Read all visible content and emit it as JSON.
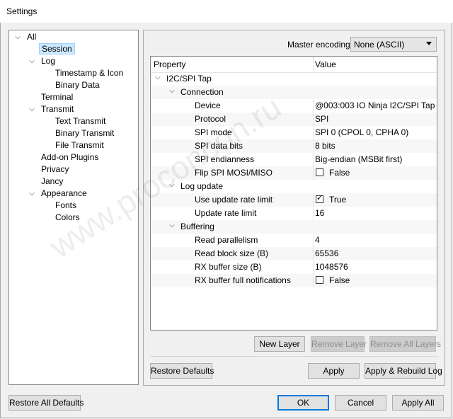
{
  "window": {
    "title": "Settings"
  },
  "tree": [
    {
      "label": "All",
      "arrow": "expanded",
      "indent": 0
    },
    {
      "label": "Session",
      "arrow": "",
      "indent": 1,
      "selected": true
    },
    {
      "label": "Log",
      "arrow": "expanded",
      "indent": 1
    },
    {
      "label": "Timestamp & Icon",
      "arrow": "",
      "indent": 2
    },
    {
      "label": "Binary Data",
      "arrow": "",
      "indent": 2
    },
    {
      "label": "Terminal",
      "arrow": "",
      "indent": 1
    },
    {
      "label": "Transmit",
      "arrow": "expanded",
      "indent": 1
    },
    {
      "label": "Text Transmit",
      "arrow": "",
      "indent": 2
    },
    {
      "label": "Binary Transmit",
      "arrow": "",
      "indent": 2
    },
    {
      "label": "File Transmit",
      "arrow": "",
      "indent": 2
    },
    {
      "label": "Add-on Plugins",
      "arrow": "",
      "indent": 1
    },
    {
      "label": "Privacy",
      "arrow": "",
      "indent": 1
    },
    {
      "label": "Jancy",
      "arrow": "",
      "indent": 1
    },
    {
      "label": "Appearance",
      "arrow": "expanded",
      "indent": 1
    },
    {
      "label": "Fonts",
      "arrow": "",
      "indent": 2
    },
    {
      "label": "Colors",
      "arrow": "",
      "indent": 2
    }
  ],
  "encoding": {
    "label": "Master encoding:",
    "value": "None (ASCII)"
  },
  "grid": {
    "header": {
      "property": "Property",
      "value": "Value"
    },
    "rows": [
      {
        "key": "I2C/SPI Tap",
        "level": 0,
        "toggle": "collapse"
      },
      {
        "key": "Connection",
        "level": 1,
        "toggle": "collapse"
      },
      {
        "key": "Device",
        "level": 2,
        "value": "@003:003 IO Ninja I2C/SPI Tap"
      },
      {
        "key": "Protocol",
        "level": 2,
        "value": "SPI"
      },
      {
        "key": "SPI mode",
        "level": 2,
        "value": "SPI 0 (CPOL 0, CPHA 0)"
      },
      {
        "key": "SPI data bits",
        "level": 2,
        "value": "8 bits"
      },
      {
        "key": "SPI endianness",
        "level": 2,
        "value": "Big-endian (MSBit first)"
      },
      {
        "key": "Flip SPI MOSI/MISO",
        "level": 2,
        "checkbox": false,
        "value": "False"
      },
      {
        "key": "Log update",
        "level": 1,
        "toggle": "collapse"
      },
      {
        "key": "Use update rate limit",
        "level": 2,
        "checkbox": true,
        "value": "True"
      },
      {
        "key": "Update rate limit",
        "level": 2,
        "value": "16"
      },
      {
        "key": "Buffering",
        "level": 1,
        "toggle": "collapse"
      },
      {
        "key": "Read parallelism",
        "level": 2,
        "value": "4"
      },
      {
        "key": "Read block size (B)",
        "level": 2,
        "value": "65536"
      },
      {
        "key": "RX buffer size (B)",
        "level": 2,
        "value": "1048576"
      },
      {
        "key": "RX buffer full notifications",
        "level": 2,
        "checkbox": false,
        "value": "False"
      }
    ]
  },
  "buttons": {
    "new_layer": "New Layer",
    "remove_layer": "Remove Layer",
    "remove_all_layers": "Remove All Layers",
    "restore_defaults": "Restore Defaults",
    "apply": "Apply",
    "apply_rebuild_log": "Apply & Rebuild Log",
    "restore_all_defaults": "Restore All Defaults",
    "ok": "OK",
    "cancel": "Cancel",
    "apply_all": "Apply All"
  },
  "watermark": "www.proconcon.ru"
}
